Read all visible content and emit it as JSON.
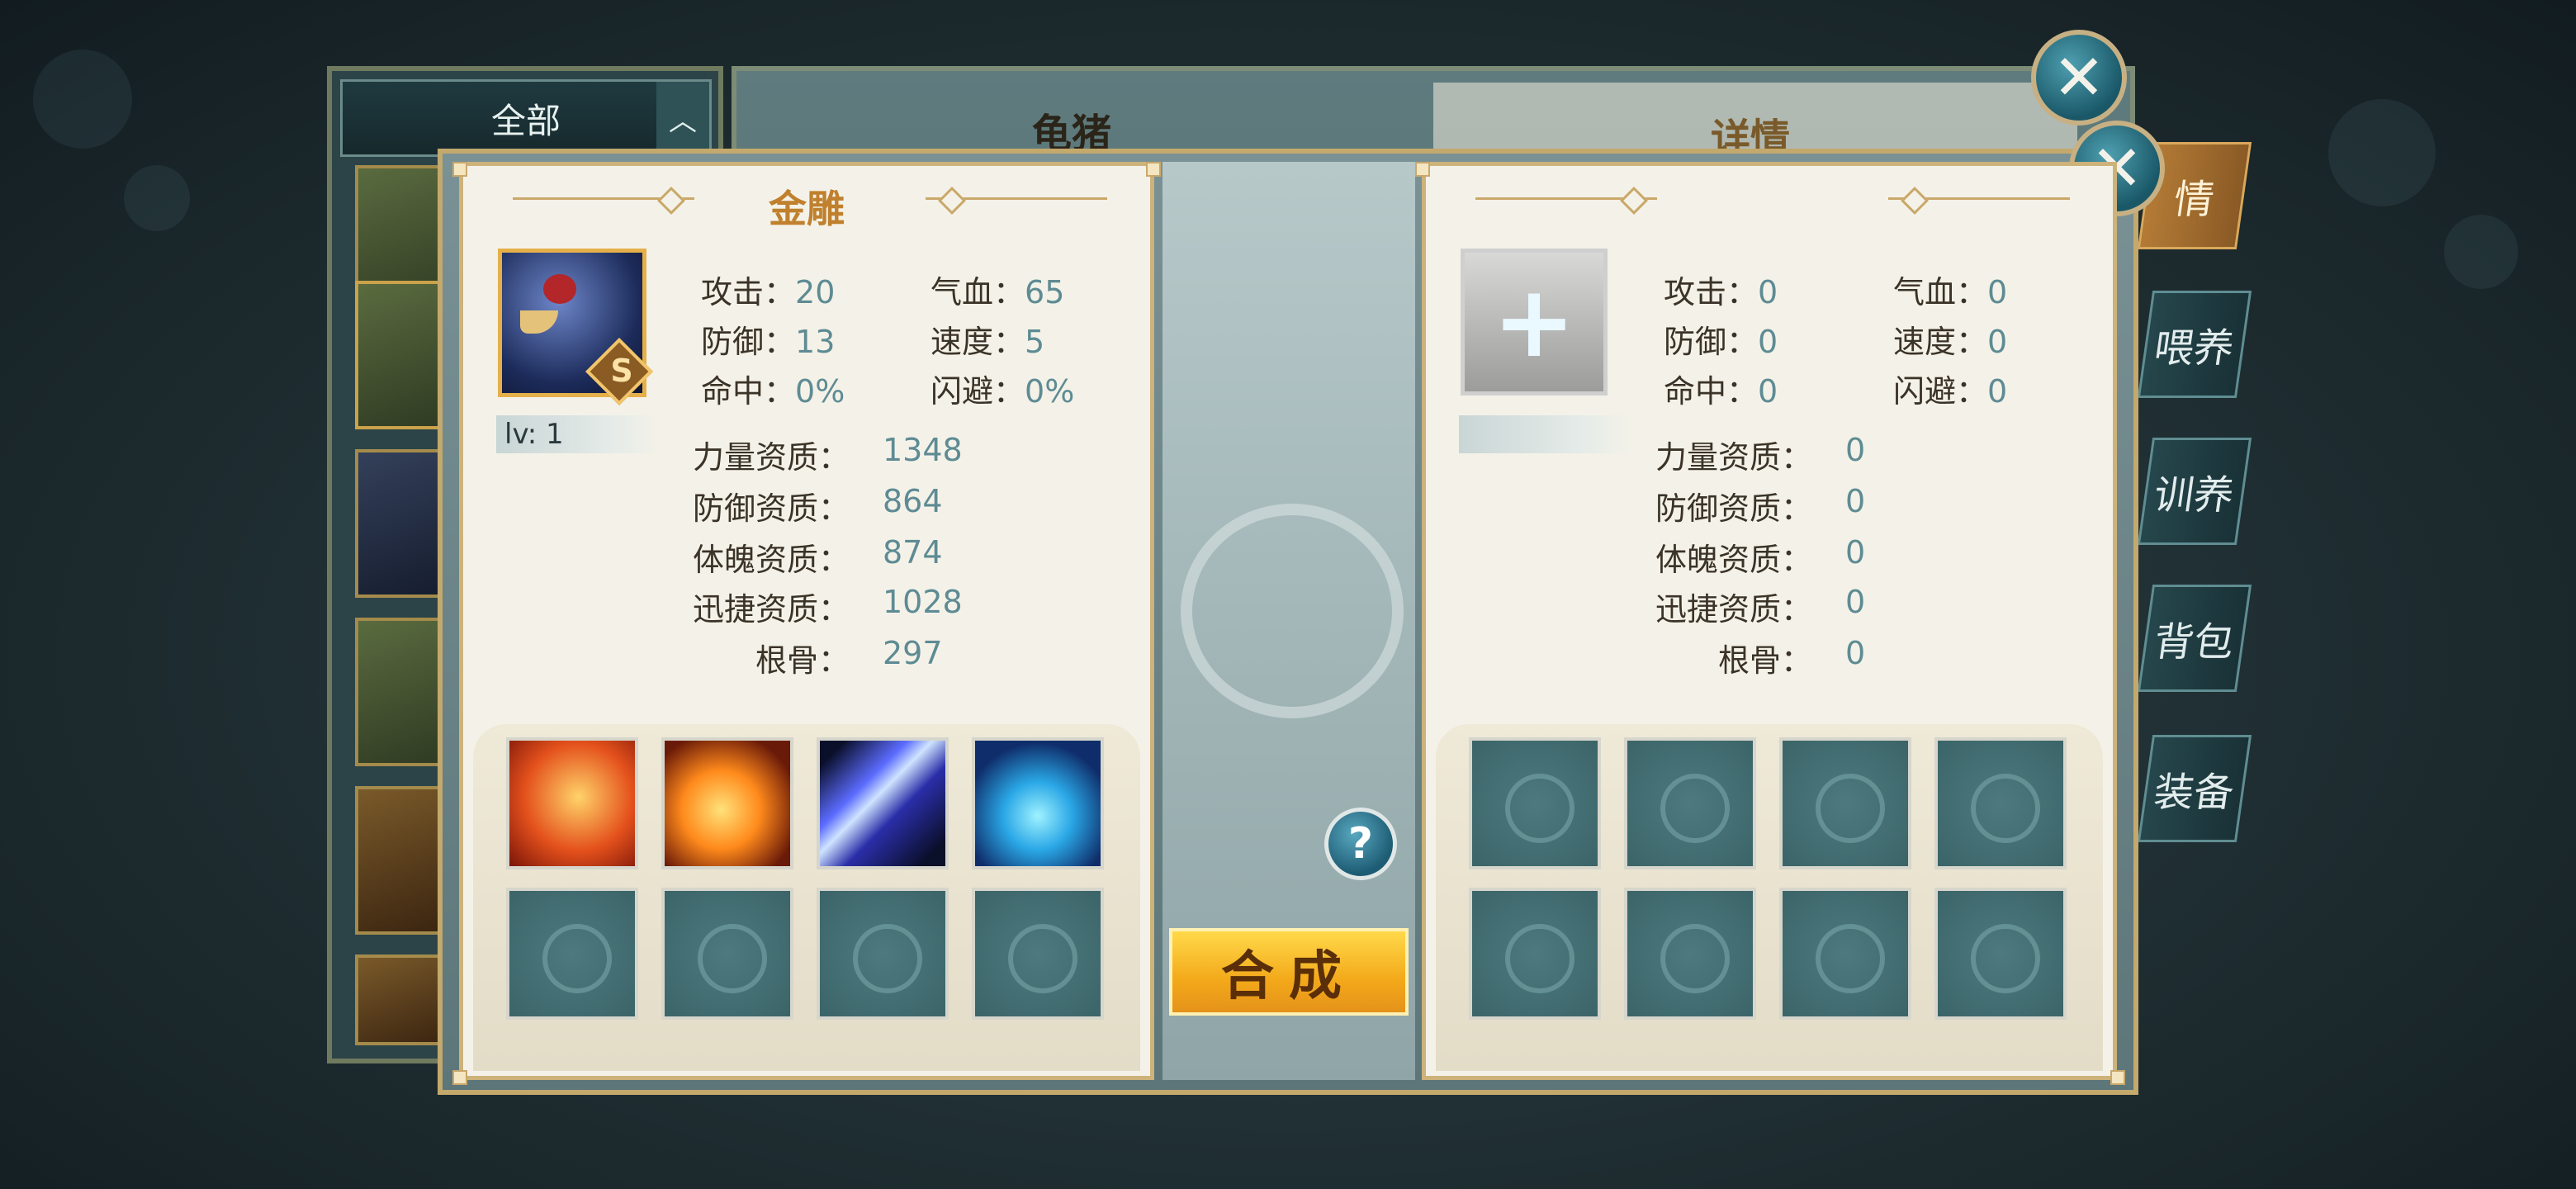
{
  "background_screen": {
    "filter_label": "全部",
    "pet_name_title": "龟猪",
    "detail_title": "详情",
    "side_tabs": [
      "情",
      "喂养",
      "训养",
      "背包",
      "装备"
    ]
  },
  "modal": {
    "left_pet": {
      "name": "金雕",
      "grade": "S",
      "level_label": "lv: 1",
      "stats": [
        {
          "label": "攻击：",
          "value": "20"
        },
        {
          "label": "气血：",
          "value": "65"
        },
        {
          "label": "防御：",
          "value": "13"
        },
        {
          "label": "速度：",
          "value": "5"
        },
        {
          "label": "命中：",
          "value": "0%"
        },
        {
          "label": "闪避：",
          "value": "0%"
        }
      ],
      "aptitudes": [
        {
          "label": "力量资质：",
          "value": "1348"
        },
        {
          "label": "防御资质：",
          "value": "864"
        },
        {
          "label": "体魄资质：",
          "value": "874"
        },
        {
          "label": "迅捷资质：",
          "value": "1028"
        },
        {
          "label": "根骨：",
          "value": "297"
        }
      ],
      "skills": [
        "fire-phoenix-skill-icon",
        "flame-bird-skill-icon",
        "claw-slash-skill-icon",
        "ice-shatter-skill-icon"
      ]
    },
    "right_pet": {
      "stats": [
        {
          "label": "攻击：",
          "value": "0"
        },
        {
          "label": "气血：",
          "value": "0"
        },
        {
          "label": "防御：",
          "value": "0"
        },
        {
          "label": "速度：",
          "value": "0"
        },
        {
          "label": "命中：",
          "value": "0"
        },
        {
          "label": "闪避：",
          "value": "0"
        }
      ],
      "aptitudes": [
        {
          "label": "力量资质：",
          "value": "0"
        },
        {
          "label": "防御资质：",
          "value": "0"
        },
        {
          "label": "体魄资质：",
          "value": "0"
        },
        {
          "label": "迅捷资质：",
          "value": "0"
        },
        {
          "label": "根骨：",
          "value": "0"
        }
      ]
    },
    "add_symbol": "+",
    "help_symbol": "?",
    "combine_label": "合成",
    "close_symbol": "✕"
  },
  "colors": {
    "accent_gold": "#c0802e",
    "value_teal": "#5e8b94",
    "button_yellow": "#f3a91a"
  }
}
